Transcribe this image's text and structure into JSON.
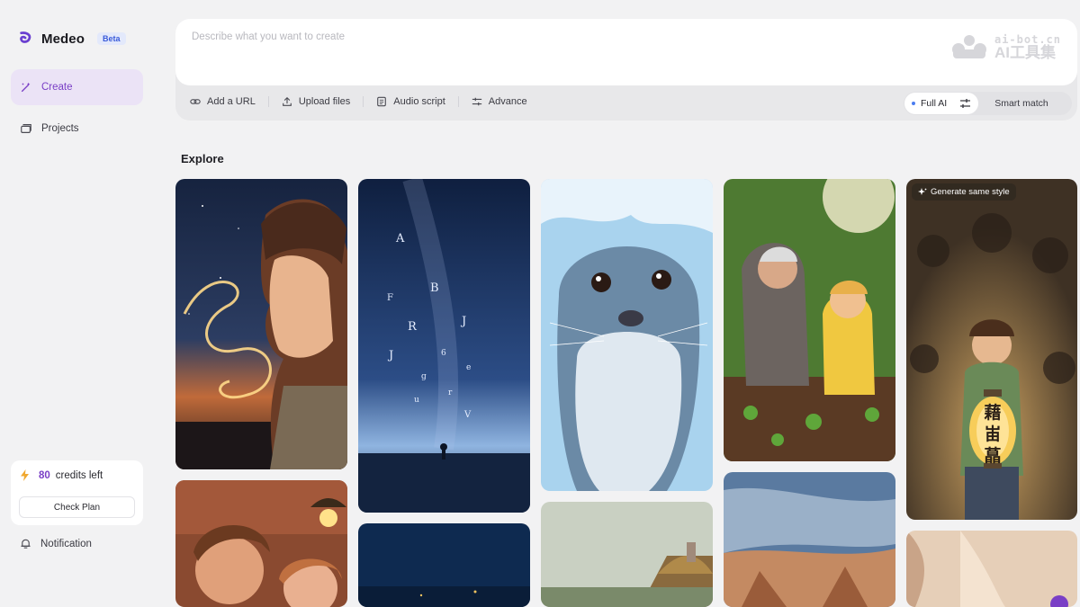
{
  "brand": {
    "name": "Medeo",
    "badge": "Beta"
  },
  "nav": {
    "create": "Create",
    "projects": "Projects"
  },
  "credits": {
    "count": "80",
    "label": "credits left",
    "check_plan": "Check Plan"
  },
  "notification": "Notification",
  "prompt": {
    "placeholder": "Describe what you want to create",
    "watermark_top": "ai-bot.cn",
    "watermark_bottom": "AI工具集"
  },
  "toolbar": {
    "add_url": "Add a URL",
    "upload": "Upload files",
    "audio_script": "Audio script",
    "advance": "Advance"
  },
  "mode": {
    "full_ai": "Full AI",
    "smart_match": "Smart match"
  },
  "explore": {
    "title": "Explore",
    "generate_same_style": "Generate same style"
  },
  "lantern_glyphs": [
    "藉",
    "峀",
    "蕌"
  ],
  "colors": {
    "accent": "#7a3fc6",
    "active_bg": "#ebe3f6",
    "badge": "#3a5bd9"
  }
}
